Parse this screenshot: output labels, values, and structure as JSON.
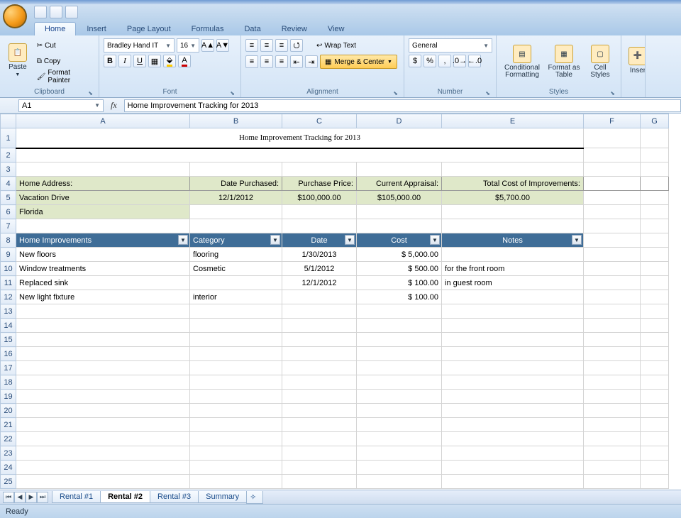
{
  "tabs": {
    "home": "Home",
    "insert": "Insert",
    "page_layout": "Page Layout",
    "formulas": "Formulas",
    "data": "Data",
    "review": "Review",
    "view": "View"
  },
  "ribbon": {
    "paste": "Paste",
    "cut": "Cut",
    "copy": "Copy",
    "fmt_painter": "Format Painter",
    "clipboard": "Clipboard",
    "font_name": "Bradley Hand IT",
    "font_size": "16",
    "font_group": "Font",
    "wrap": "Wrap Text",
    "merge": "Merge & Center",
    "alignment": "Alignment",
    "num_fmt": "General",
    "number": "Number",
    "cond": "Conditional Formatting",
    "fmt_tbl": "Format as Table",
    "cell_sty": "Cell Styles",
    "styles": "Styles",
    "insert_btn": "Inser"
  },
  "namebox": "A1",
  "formula": "Home Improvement Tracking for 2013",
  "columns": [
    "A",
    "B",
    "C",
    "D",
    "E",
    "F",
    "G"
  ],
  "title": "Home Improvement Tracking for 2013",
  "header_labels": {
    "addr": "Home Address:",
    "purchased": "Date Purchased:",
    "price": "Purchase Price:",
    "appraisal": "Current Appraisal:",
    "total": "Total Cost of Improvements:"
  },
  "header_values": {
    "addr": "Vacation Drive",
    "purchased": "12/1/2012",
    "price": "$100,000.00",
    "appraisal": "$105,000.00",
    "total": "$5,700.00",
    "state": "Florida"
  },
  "table_cols": {
    "improv": "Home Improvements",
    "cat": "Category",
    "date": "Date",
    "cost": "Cost",
    "notes": "Notes"
  },
  "rows": [
    {
      "a": "New floors",
      "b": "flooring",
      "c": "1/30/2013",
      "d": "$        5,000.00",
      "e": ""
    },
    {
      "a": "Window treatments",
      "b": "Cosmetic",
      "c": "5/1/2012",
      "d": "$           500.00",
      "e": "for the front room"
    },
    {
      "a": "Replaced sink",
      "b": "",
      "c": "12/1/2012",
      "d": "$           100.00",
      "e": "in guest room"
    },
    {
      "a": "New light fixture",
      "b": "interior",
      "c": "",
      "d": "$           100.00",
      "e": ""
    }
  ],
  "sheet_tabs": [
    "Rental #1",
    "Rental #2",
    "Rental #3",
    "Summary"
  ],
  "active_sheet": "Rental #2",
  "status": "Ready"
}
